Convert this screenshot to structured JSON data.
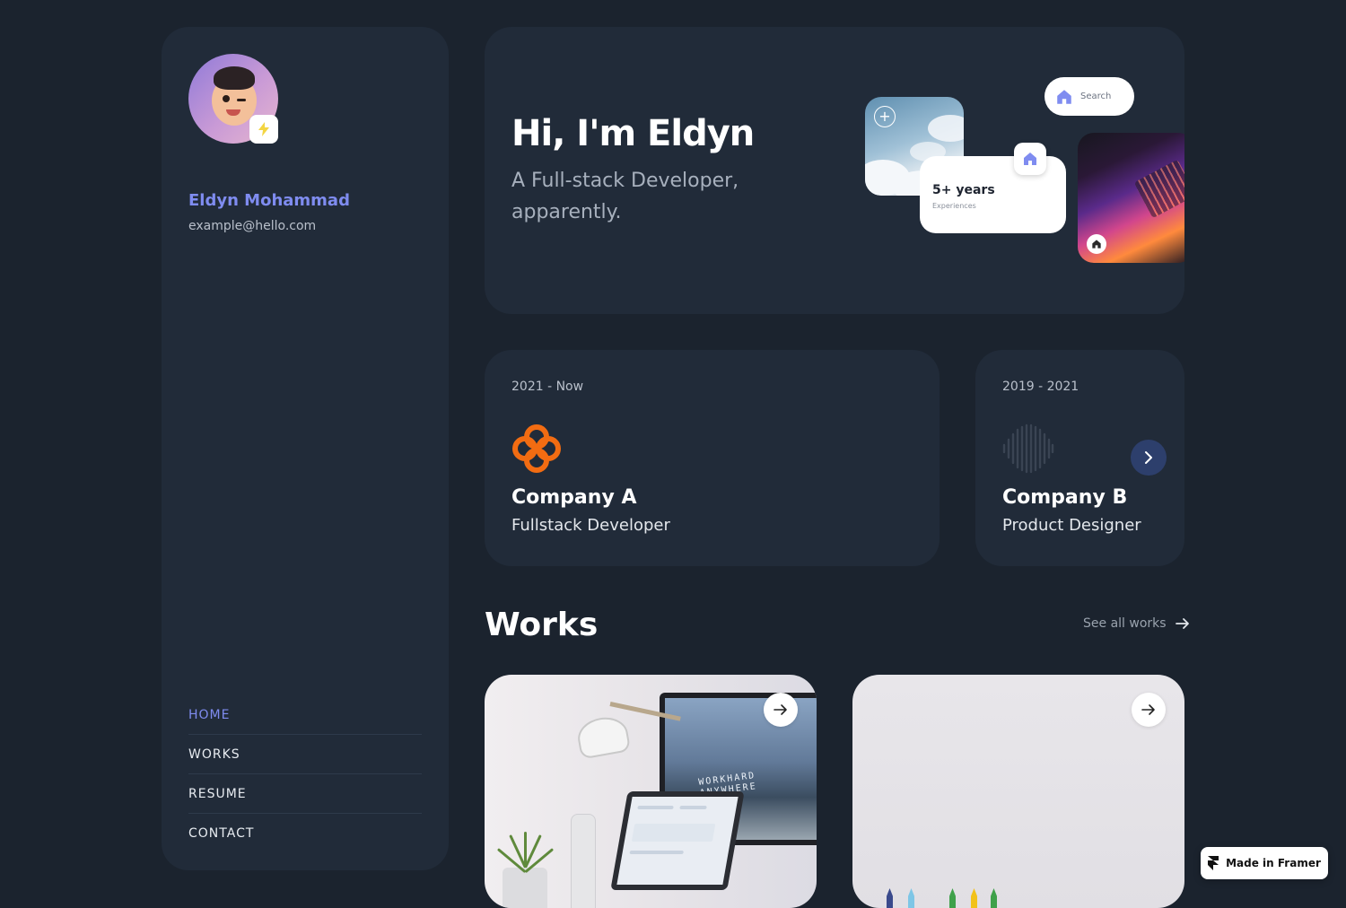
{
  "profile": {
    "name": "Eldyn Mohammad",
    "email": "example@hello.com"
  },
  "nav": {
    "items": [
      {
        "label": "HOME",
        "active": true
      },
      {
        "label": "WORKS",
        "active": false
      },
      {
        "label": "RESUME",
        "active": false
      },
      {
        "label": "CONTACT",
        "active": false
      }
    ]
  },
  "hero": {
    "title": "Hi, I'm Eldyn",
    "subtitle": "A Full-stack Developer, apparently.",
    "search_pill": {
      "label": "Search",
      "icon": "home-icon"
    },
    "years_card": {
      "main": "5+ years",
      "sub": "Experiences"
    }
  },
  "experience": [
    {
      "period": "2021 - Now",
      "company": "Company A",
      "role": "Fullstack Developer",
      "logo": "clover-logo"
    },
    {
      "period": "2019 - 2021",
      "company": "Company B",
      "role": "Product Designer",
      "logo": "soundwave-logo"
    }
  ],
  "works": {
    "title": "Works",
    "see_all": "See all works",
    "monitor_text": "WORKHARD ANYWHERE"
  },
  "framer_badge": "Made in Framer",
  "colors": {
    "background": "#1b232e",
    "card": "#212b39",
    "accent": "#7f8cf0",
    "company_a_logo": "#f26c12",
    "nav_button": "#2d3f6c"
  }
}
